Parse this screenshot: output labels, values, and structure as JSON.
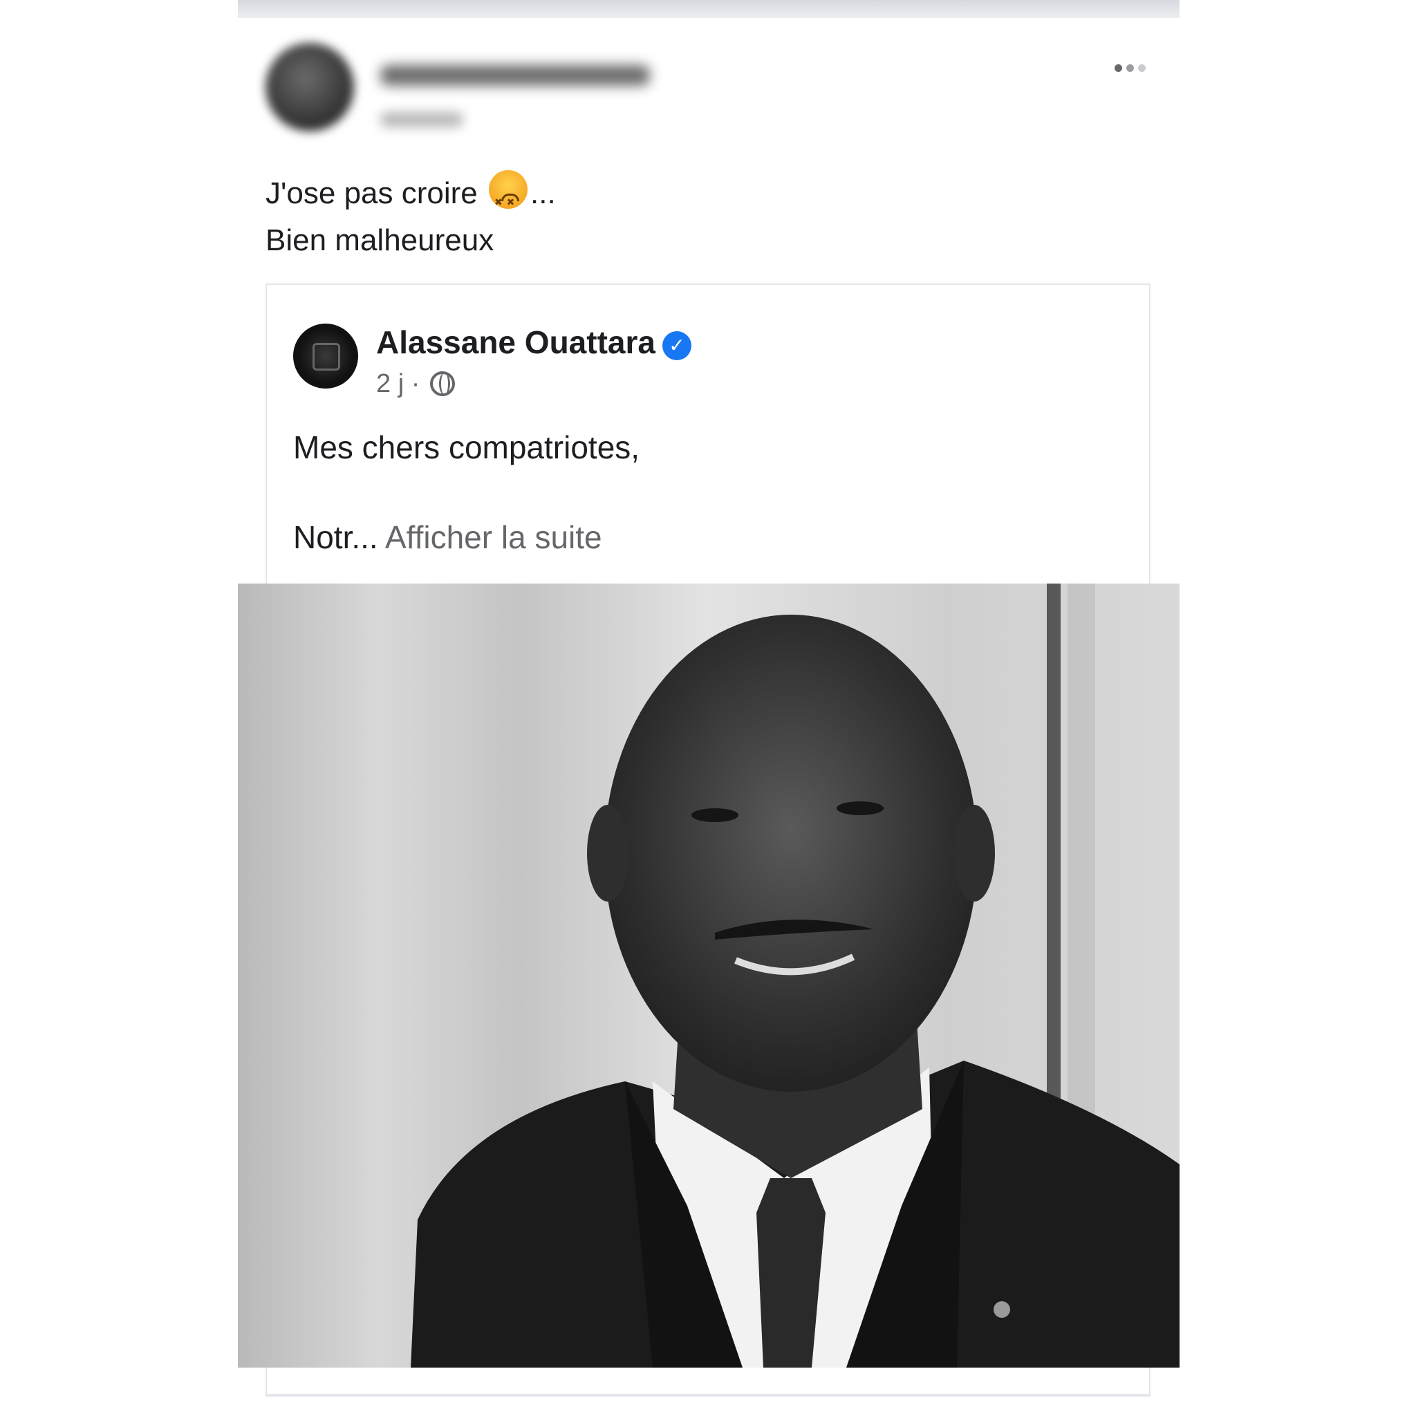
{
  "post": {
    "text_line1": "J'ose pas croire",
    "text_line1_suffix": "...",
    "text_line2": "Bien malheureux",
    "emoji_name": "persevering-face-emoji"
  },
  "shared_post": {
    "page_name": "Alassane Ouattara",
    "verified": true,
    "time": "2 j",
    "separator": "·",
    "visibility_icon": "globe-icon",
    "greeting": "Mes chers compatriotes,",
    "excerpt": "Notr...",
    "see_more": "Afficher la suite"
  },
  "colors": {
    "verified_blue": "#1877f2",
    "text_primary": "#1c1e21",
    "text_secondary": "#65676b",
    "border": "#e4e6eb"
  }
}
